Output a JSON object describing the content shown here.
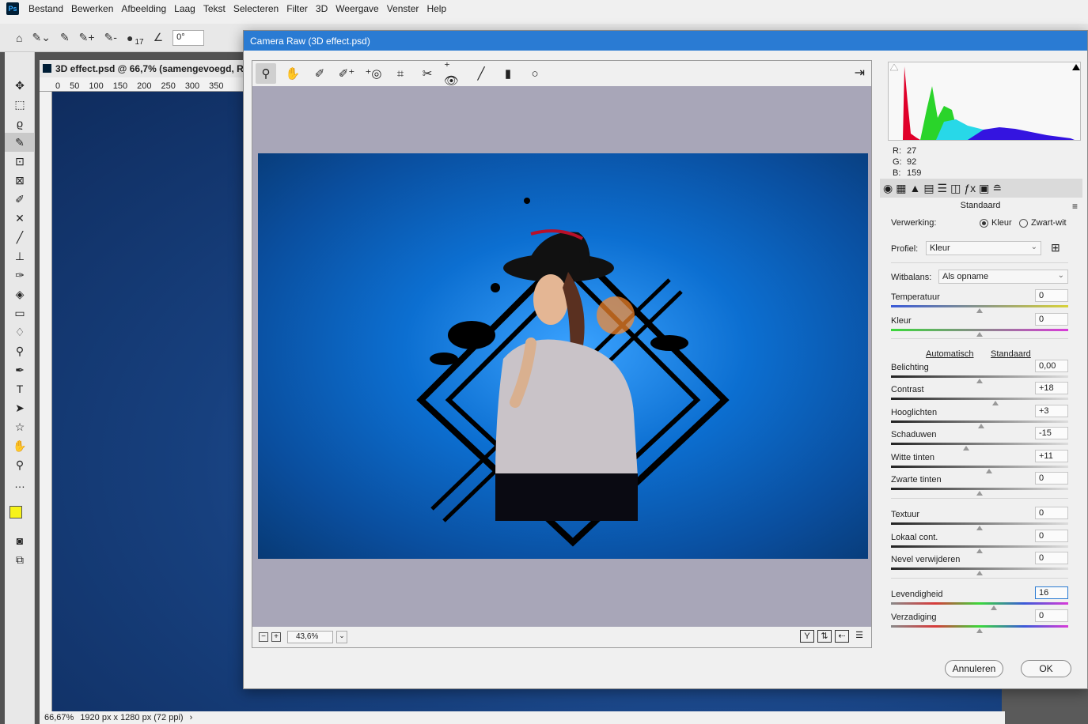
{
  "app": {
    "logo": "Ps",
    "menu": [
      "Bestand",
      "Bewerken",
      "Afbeelding",
      "Laag",
      "Tekst",
      "Selecteren",
      "Filter",
      "3D",
      "Weergave",
      "Venster",
      "Help"
    ]
  },
  "options": {
    "brush_size": "17",
    "angle": "0°"
  },
  "document": {
    "tab_title": "3D effect.psd @ 66,7% (samengevoegd, R",
    "ruler_ticks": [
      "0",
      "50",
      "100",
      "150",
      "200",
      "250",
      "300",
      "350"
    ],
    "status_zoom": "66,67%",
    "status_dims": "1920 px x 1280 px (72 ppi)",
    "canvas_color": "#17407e"
  },
  "foreground_color": "#f7f31a",
  "camera_raw": {
    "title": "Camera Raw (3D effect.psd)",
    "zoom": "43,6%",
    "rgb": {
      "r_label": "R:",
      "r": "27",
      "g_label": "G:",
      "g": "92",
      "b_label": "B:",
      "b": "159"
    },
    "preset_title": "Standaard",
    "processing_label": "Verwerking:",
    "processing_color": "Kleur",
    "processing_bw": "Zwart-wit",
    "profile_label": "Profiel:",
    "profile_value": "Kleur",
    "wb_label": "Witbalans:",
    "wb_value": "Als opname",
    "auto_link": "Automatisch",
    "default_link": "Standaard",
    "sliders": [
      {
        "label": "Temperatuur",
        "value": "0"
      },
      {
        "label": "Kleur",
        "value": "0"
      },
      {
        "label": "Belichting",
        "value": "0,00"
      },
      {
        "label": "Contrast",
        "value": "+18"
      },
      {
        "label": "Hooglichten",
        "value": "+3"
      },
      {
        "label": "Schaduwen",
        "value": "-15"
      },
      {
        "label": "Witte tinten",
        "value": "+11"
      },
      {
        "label": "Zwarte tinten",
        "value": "0"
      },
      {
        "label": "Textuur",
        "value": "0"
      },
      {
        "label": "Lokaal cont.",
        "value": "0"
      },
      {
        "label": "Nevel verwijderen",
        "value": "0"
      },
      {
        "label": "Levendigheid",
        "value": "16"
      },
      {
        "label": "Verzadiging",
        "value": "0"
      }
    ],
    "cancel": "Annuleren",
    "ok": "OK",
    "accent": "#2a7bd3"
  }
}
